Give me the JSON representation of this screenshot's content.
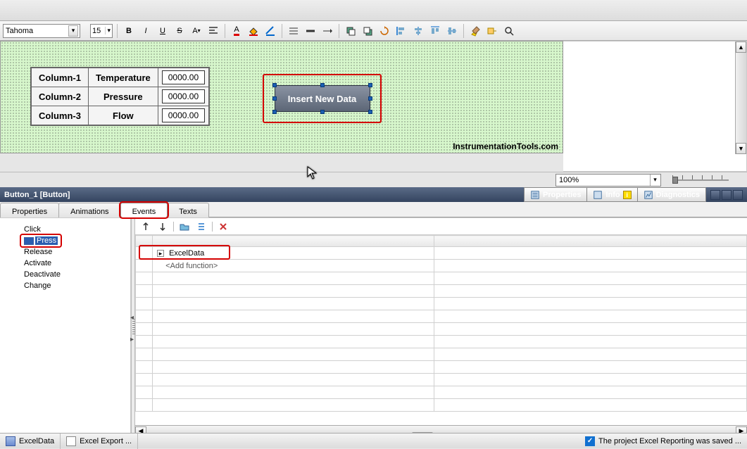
{
  "toolbar": {
    "font": "Tahoma",
    "size": "15",
    "zoom": "100%"
  },
  "canvas": {
    "table": {
      "rows": [
        {
          "col": "Column-1",
          "label": "Temperature",
          "value": "0000.00"
        },
        {
          "col": "Column-2",
          "label": "Pressure",
          "value": "0000.00"
        },
        {
          "col": "Column-3",
          "label": "Flow",
          "value": "0000.00"
        }
      ]
    },
    "insert_button_label": "Insert New Data",
    "watermark": "InstrumentationTools.com"
  },
  "selected_object_title": "Button_1 [Button]",
  "inspector_tabs": {
    "properties": "Properties",
    "animations": "Animations",
    "events": "Events",
    "texts": "Texts"
  },
  "right_tabs": {
    "properties": "Properties",
    "info": "Info",
    "diagnostics": "Diagnostics"
  },
  "event_list": {
    "click": "Click",
    "press": "Press",
    "release": "Release",
    "activate": "Activate",
    "deactivate": "Deactivate",
    "change": "Change"
  },
  "script_rows": {
    "row1": "ExcelData",
    "add": "<Add function>"
  },
  "statusbar": {
    "item1": "ExcelData",
    "item2": "Excel Export ...",
    "saved_msg": "The project Excel Reporting was saved ..."
  }
}
